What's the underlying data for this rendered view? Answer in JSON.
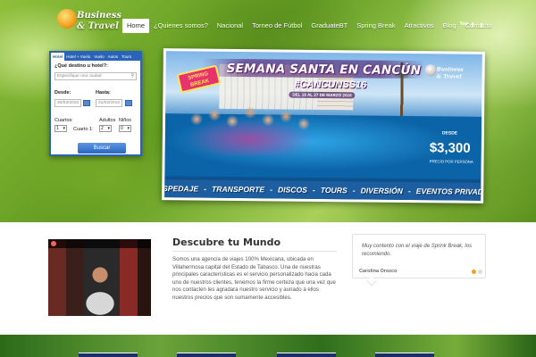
{
  "logo": {
    "line1": "Business",
    "line2": "& Travel"
  },
  "nav": {
    "items": [
      "Home",
      "¿Quienes somos?",
      "Nacional",
      "Torneo de Fútbol",
      "GraduateBT",
      "Spring Break",
      "Atractivos",
      "Blog",
      "Contacto"
    ],
    "active_index": 0,
    "social": [
      "You",
      "f",
      "t"
    ]
  },
  "booking": {
    "tabs": [
      "Hotel",
      "Hotel + Vuelo",
      "Vuelo",
      "Autos",
      "Tours"
    ],
    "active_tab": "Hotel",
    "destination_label": "¿Qué destino u hotel?:",
    "destination_placeholder": "Especifique una ciudad",
    "from_label": "Desde:",
    "from_value": "30/03/2016",
    "to_label": "Hasta:",
    "to_value": "31/03/2016",
    "rooms_label": "Cuartos:",
    "rooms_value": "1",
    "adults_label": "Adultos",
    "adults_value": "2",
    "children_label": "Niños",
    "children_value": "0",
    "room1_label": "Cuarto 1:",
    "room1_value": "1",
    "search_button": "Buscar"
  },
  "promo": {
    "title": "SEMANA SANTA EN CANCÚN",
    "hashtag": "#CANCUNSS16",
    "dates": "DEL 19 AL 27 DE MARZO 2016",
    "badge_line1": "SPRING",
    "badge_line2": "BREAK",
    "logo_line1": "Business",
    "logo_line2": "& Travel",
    "price_label": "DESDE",
    "price": "$3,300",
    "price_sub": "PRECIO POR PERSONA",
    "services": [
      "HOSPEDAJE",
      "TRANSPORTE",
      "DISCOS",
      "TOURS",
      "DIVERSIÓN",
      "EVENTOS PRIVADOS"
    ]
  },
  "about": {
    "title": "Descubre tu Mundo",
    "body": "Somos una agencia de viajes 100% Mexicana, ubicada en Villahermosa capital del Estado de Tabasco. Una de nuestras principales características es el servicio personalizado hacia cada uno de nuestros clientes, tenemos la firme certeza que una vez que nos contacten les agradara nuestro servicio y aunado a ellos nuestros precios que son sumamente accesibles."
  },
  "testimonial": {
    "text": "Muy contento con el viaje de Sprink Break, los recomiendo.",
    "author": "Carolina Orozco",
    "dot_colors": [
      "#f0a020",
      "#cfe6d0"
    ]
  },
  "colors": {
    "accent": "#2a64b8",
    "promo_bar": "#1c5ea0",
    "nav_active_bg": "#ffffff"
  }
}
